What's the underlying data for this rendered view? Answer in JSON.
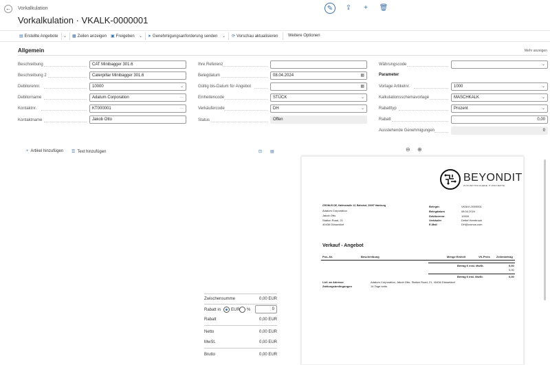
{
  "header": {
    "breadcrumb": "Vorkalkulation",
    "title": "Vorkalkulation · VKALK-0000001"
  },
  "actions": {
    "a1": "Erstellte Angebote",
    "a2": "Zeilen anzeigen",
    "a3": "Freigeben",
    "a4": "Genehmigungsanforderung senden",
    "a5": "Vorschau aktualisieren",
    "a6": "Weitere Optionen"
  },
  "section": {
    "title": "Allgemein",
    "more": "Mehr anzeigen"
  },
  "col1": [
    {
      "label": "Beschreibung",
      "value": "CAT Minibagger 301.6"
    },
    {
      "label": "Beschreibung 2",
      "value": "Caterpillar Minibagger 301.6"
    },
    {
      "label": "Debitorennr.",
      "value": "10000"
    },
    {
      "label": "Debitorname",
      "value": "Adatum Corporation"
    },
    {
      "label": "Kontaktnr.",
      "value": "KT000001"
    },
    {
      "label": "Kontaktname",
      "value": "Jakob Otto"
    }
  ],
  "col2": [
    {
      "label": "Ihre Referenz",
      "value": ""
    },
    {
      "label": "Belegdatum",
      "value": "08.04.2024"
    },
    {
      "label": "Gültig bis-Datum für Angebot",
      "value": ""
    },
    {
      "label": "Einheitencode",
      "value": "STÜCK"
    },
    {
      "label": "Verkäufercode",
      "value": "DH"
    },
    {
      "label": "Status",
      "value": "Offen"
    }
  ],
  "col3": {
    "currency_label": "Währungscode",
    "currency_value": "",
    "params_title": "Parameter",
    "rows": [
      {
        "label": "Vorlage Artikelnr.",
        "value": "1000"
      },
      {
        "label": "Kalkulationsschemavorlage",
        "value": "MASCHKALK"
      },
      {
        "label": "Rabatttyp",
        "value": "Prozent"
      },
      {
        "label": "Rabatt",
        "value": "0,00"
      },
      {
        "label": "Ausstehende Genehmigungen",
        "value": "0"
      }
    ]
  },
  "tools": {
    "add_item": "Artikel hinzufügen",
    "add_text": "Text hinzufügen"
  },
  "totals": {
    "subtotal_label": "Zwischensumme",
    "subtotal": "0,00 EUR",
    "discount_in": "Rabatt in",
    "opt_eur": "EUR",
    "opt_pct": "%",
    "discount_input": "0",
    "discount_label": "Rabatt",
    "discount": "0,00 EUR",
    "net_label": "Netto",
    "net": "0,00 EUR",
    "vat_label": "MwSt.",
    "vat": "0,00 EUR",
    "gross_label": "Brutto",
    "gross": "0,00 EUR"
  },
  "preview": {
    "logo": "BEYONDIT",
    "tagline": "ZUKUNFTSSICHERE IT-PROJEKTE",
    "sender": "CRONUS DE, Hafenstraße 12, Bahnhof, 20097 Hamburg",
    "address": [
      "Adatum Corporation",
      "Jakob Otto",
      "Station Road, 21",
      "40436 Düsseldorf"
    ],
    "meta": [
      {
        "k": "Belegnr.",
        "v": "VKALK-0000001"
      },
      {
        "k": "Belegdatum",
        "v": "08.04.2024"
      },
      {
        "k": "Debitorennr.",
        "v": "10000"
      },
      {
        "k": "Verkäufer",
        "v": "Detlef Hembrook"
      },
      {
        "k": "E-Mail",
        "v": "DH@cronus.com"
      }
    ],
    "doc_title": "Verkauf - Angebot",
    "cols": {
      "pos": "Pos.-Nr.",
      "desc": "Beschreibung",
      "qty": "Menge Einheit",
      "price": "VK-Preis",
      "amount": "Zeilenbetrag"
    },
    "sum1_label": "Betrag € exkl. MwSt.",
    "sum1": "0,00",
    "sum1b": "0,00",
    "sum2_label": "Betrag € inkl. MwSt.",
    "sum2": "0,00",
    "ship_label": "Lief. an Adresse",
    "ship_value": "Adatum Corporation, Jakob Otto, Station Road, 21, 40436 Düsseldorf",
    "pay_label": "Zahlungsbedingungen",
    "pay_value": "14 Tage netto"
  }
}
